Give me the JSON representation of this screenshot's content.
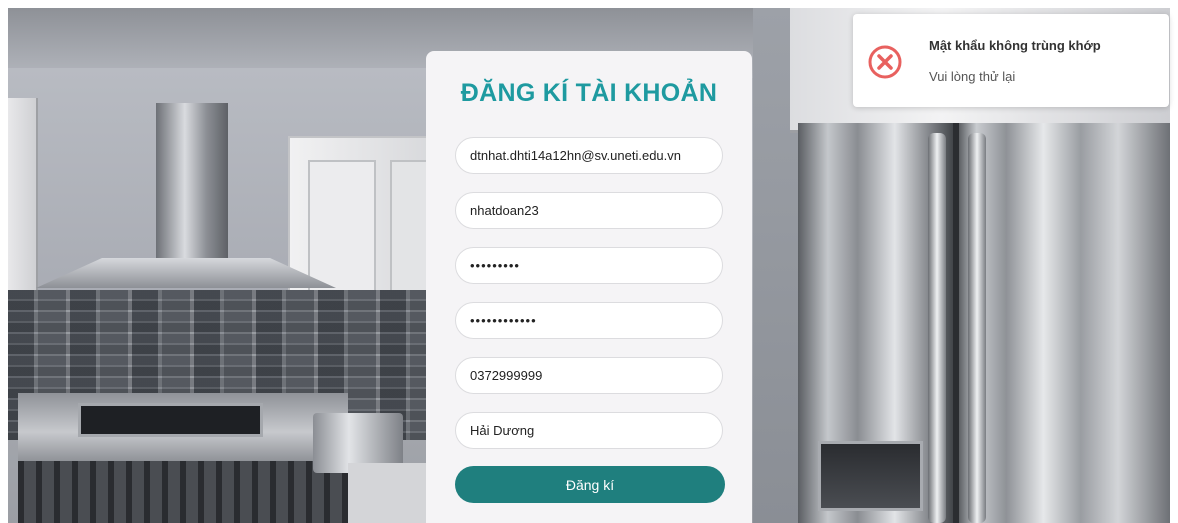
{
  "form": {
    "title": "ĐĂNG KÍ TÀI KHOẢN",
    "fields": [
      {
        "value": "dtnhat.dhti14a12hn@sv.uneti.edu.vn",
        "type": "text"
      },
      {
        "value": "nhatdoan23",
        "type": "text"
      },
      {
        "value": "•••••••••",
        "type": "password"
      },
      {
        "value": "••••••••••••",
        "type": "password"
      },
      {
        "value": "0372999999",
        "type": "text"
      },
      {
        "value": "Hải Dương",
        "type": "text"
      }
    ],
    "submit_label": "Đăng kí"
  },
  "toast": {
    "icon": "error-circle-x-icon",
    "title": "Mật khẩu không trùng khớp",
    "message": "Vui lòng thử lại",
    "color": "#e8615f"
  },
  "colors": {
    "title": "#1e9aa0",
    "button": "#1f7f7e"
  }
}
